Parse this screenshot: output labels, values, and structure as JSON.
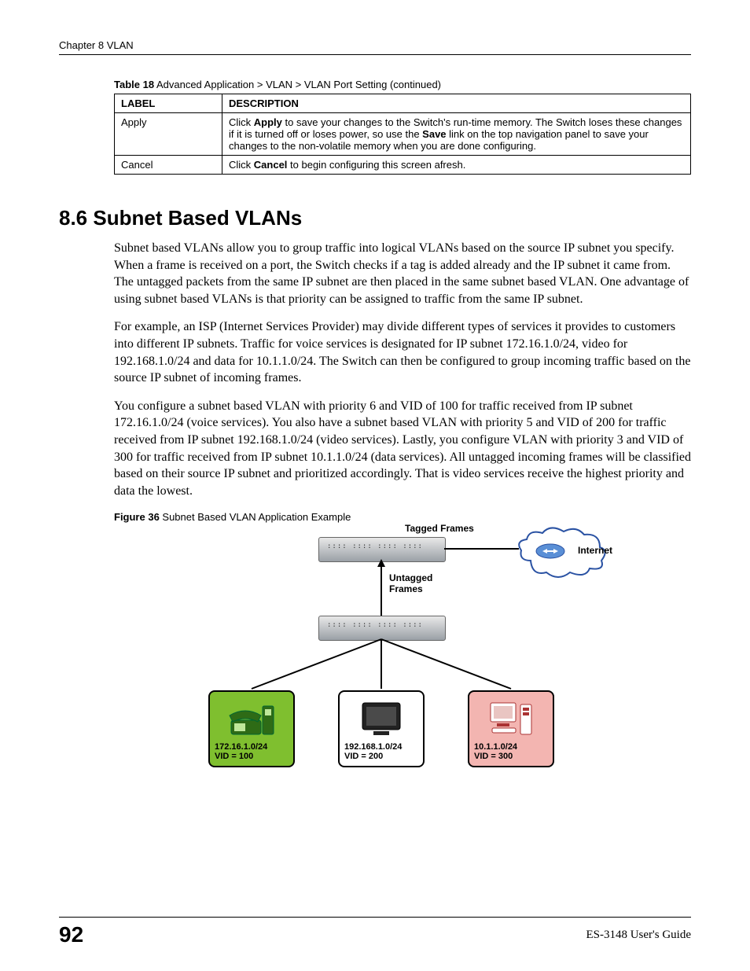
{
  "header": {
    "chapter": "Chapter 8 VLAN"
  },
  "table": {
    "caption_prefix": "Table 18",
    "caption_rest": "   Advanced Application > VLAN > VLAN Port Setting  (continued)",
    "columns": {
      "label": "LABEL",
      "description": "DESCRIPTION"
    },
    "rows": [
      {
        "label": "Apply",
        "desc_html": "Click <b>Apply</b> to save your changes to the Switch's run-time memory. The Switch loses these changes if it is turned off or loses power, so use the <b>Save</b> link on the top navigation panel to save your changes to the non-volatile memory when you are done configuring."
      },
      {
        "label": "Cancel",
        "desc_html": "Click <b>Cancel</b> to begin configuring this screen afresh."
      }
    ]
  },
  "section": {
    "heading": "8.6  Subnet Based VLANs",
    "paragraphs": [
      "Subnet based VLANs allow you to group traffic into logical VLANs based on the source IP subnet you specify. When a frame is received on a port, the Switch checks if a tag is added already and the IP subnet it came from. The untagged packets from the same IP subnet are then placed in the same subnet based VLAN. One advantage of using subnet based VLANs is that priority can be assigned to traffic from the same IP subnet.",
      "For example, an ISP (Internet Services Provider) may divide different types of services it provides to customers into different IP subnets. Traffic for voice services is designated for IP subnet 172.16.1.0/24, video for 192.168.1.0/24 and data for 10.1.1.0/24. The Switch can then be configured to group incoming traffic based on the source IP subnet of incoming frames.",
      "You configure a subnet based VLAN with priority 6 and VID of 100 for traffic received from IP subnet 172.16.1.0/24 (voice services). You also have a subnet based VLAN with priority 5 and VID of 200 for traffic received from IP subnet 192.168.1.0/24 (video services). Lastly, you configure VLAN with priority 3 and VID of 300 for traffic received from IP subnet 10.1.1.0/24 (data services). All untagged incoming frames will be classified based on their source IP subnet and prioritized accordingly. That is video services receive the highest priority and data the lowest."
    ]
  },
  "figure": {
    "caption_prefix": "Figure 36",
    "caption_rest": "   Subnet Based VLAN Application Example",
    "labels": {
      "tagged": "Tagged Frames",
      "untagged1": "Untagged",
      "untagged2": "Frames",
      "internet": "Internet"
    },
    "devices": [
      {
        "subnet": "172.16.1.0/24",
        "vid": "VID = 100",
        "box_class": "dev-green",
        "kind": "phone"
      },
      {
        "subnet": "192.168.1.0/24",
        "vid": "VID = 200",
        "box_class": "dev-white",
        "kind": "tv"
      },
      {
        "subnet": "10.1.1.0/24",
        "vid": "VID = 300",
        "box_class": "dev-pink",
        "kind": "pc"
      }
    ]
  },
  "footer": {
    "page": "92",
    "guide": "ES-3148 User's Guide"
  }
}
